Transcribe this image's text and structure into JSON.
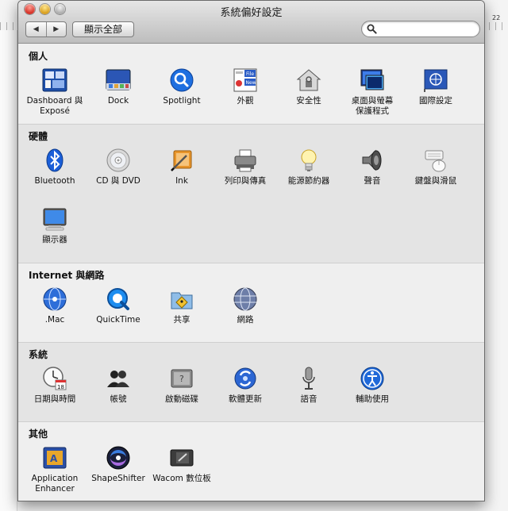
{
  "window": {
    "title": "系統偏好設定",
    "back_label": "◀",
    "forward_label": "▶",
    "show_all_label": "顯示全部",
    "search": {
      "value": "",
      "placeholder": ""
    }
  },
  "background": {
    "ruler_number": "22"
  },
  "sections": [
    {
      "title": "個人",
      "items": [
        {
          "label": "Dashboard 與\nExposé",
          "icon": "dashboard-expose-icon"
        },
        {
          "label": "Dock",
          "icon": "dock-icon"
        },
        {
          "label": "Spotlight",
          "icon": "spotlight-icon"
        },
        {
          "label": "外觀",
          "icon": "appearance-icon"
        },
        {
          "label": "安全性",
          "icon": "security-icon"
        },
        {
          "label": "桌面與螢幕\n保護程式",
          "icon": "desktop-screensaver-icon"
        },
        {
          "label": "國際設定",
          "icon": "international-icon"
        }
      ]
    },
    {
      "title": "硬體",
      "items": [
        {
          "label": "Bluetooth",
          "icon": "bluetooth-icon"
        },
        {
          "label": "CD 與 DVD",
          "icon": "cd-dvd-icon"
        },
        {
          "label": "Ink",
          "icon": "ink-icon"
        },
        {
          "label": "列印與傳真",
          "icon": "print-fax-icon"
        },
        {
          "label": "能源節約器",
          "icon": "energy-saver-icon"
        },
        {
          "label": "聲音",
          "icon": "sound-icon"
        },
        {
          "label": "鍵盤與滑鼠",
          "icon": "keyboard-mouse-icon"
        },
        {
          "label": "顯示器",
          "icon": "displays-icon"
        }
      ]
    },
    {
      "title": "Internet 與網路",
      "items": [
        {
          "label": ".Mac",
          "icon": "dotmac-icon"
        },
        {
          "label": "QuickTime",
          "icon": "quicktime-icon"
        },
        {
          "label": "共享",
          "icon": "sharing-icon"
        },
        {
          "label": "網路",
          "icon": "network-icon"
        }
      ]
    },
    {
      "title": "系統",
      "items": [
        {
          "label": "日期與時間",
          "icon": "date-time-icon"
        },
        {
          "label": "帳號",
          "icon": "accounts-icon"
        },
        {
          "label": "啟動磁碟",
          "icon": "startup-disk-icon"
        },
        {
          "label": "軟體更新",
          "icon": "software-update-icon"
        },
        {
          "label": "語音",
          "icon": "speech-icon"
        },
        {
          "label": "輔助使用",
          "icon": "universal-access-icon"
        }
      ]
    },
    {
      "title": "其他",
      "items": [
        {
          "label": "Application\nEnhancer",
          "icon": "application-enhancer-icon"
        },
        {
          "label": "ShapeShifter",
          "icon": "shapeshifter-icon"
        },
        {
          "label": "Wacom 數位板",
          "icon": "wacom-tablet-icon"
        }
      ]
    }
  ]
}
